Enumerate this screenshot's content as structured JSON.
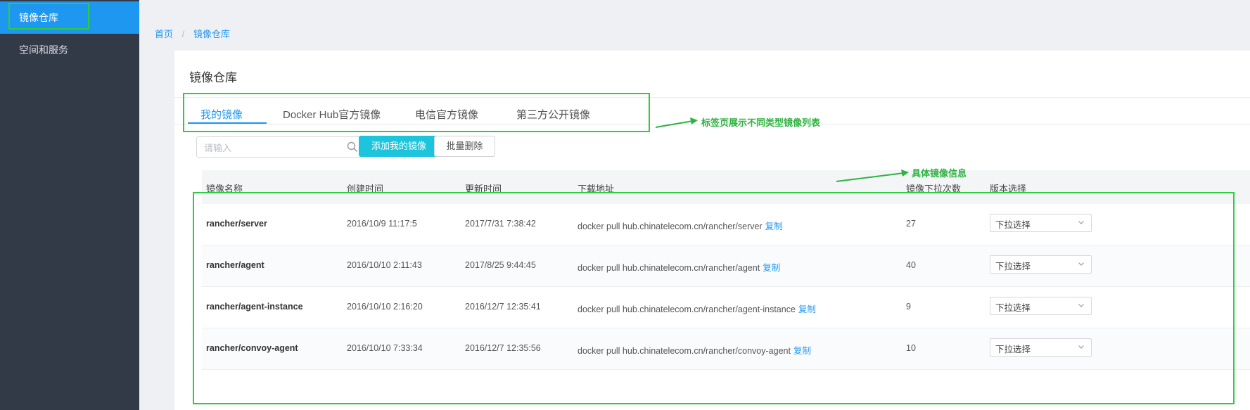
{
  "sidebar": {
    "items": [
      {
        "label": "镜像仓库"
      },
      {
        "label": "空间和服务"
      }
    ]
  },
  "breadcrumb": {
    "home": "首页",
    "current": "镜像仓库"
  },
  "page": {
    "title": "镜像仓库"
  },
  "tabs": [
    {
      "label": "我的镜像"
    },
    {
      "label": "Docker Hub官方镜像"
    },
    {
      "label": "电信官方镜像"
    },
    {
      "label": "第三方公开镜像"
    }
  ],
  "search": {
    "placeholder": "请输入"
  },
  "buttons": {
    "add": "添加我的镜像",
    "batch_delete": "批量删除"
  },
  "annotations": {
    "tabs_note": "标签页展示不同类型镜像列表",
    "table_note": "具体镜像信息"
  },
  "table": {
    "headers": [
      "镜像名称",
      "创建时间",
      "更新时间",
      "下载地址",
      "镜像下拉次数",
      "版本选择"
    ],
    "copy_label": "复制",
    "select_placeholder": "下拉选择",
    "rows": [
      {
        "name": "rancher/server",
        "created": "2016/10/9 11:17:5",
        "updated": "2017/7/31 7:38:42",
        "pull": "docker pull hub.chinatelecom.cn/rancher/server",
        "count": "27"
      },
      {
        "name": "rancher/agent",
        "created": "2016/10/10 2:11:43",
        "updated": "2017/8/25 9:44:45",
        "pull": "docker pull hub.chinatelecom.cn/rancher/agent",
        "count": "40"
      },
      {
        "name": "rancher/agent-instance",
        "created": "2016/10/10 2:16:20",
        "updated": "2016/12/7 12:35:41",
        "pull": "docker pull hub.chinatelecom.cn/rancher/agent-instance",
        "count": "9"
      },
      {
        "name": "rancher/convoy-agent",
        "created": "2016/10/10 7:33:34",
        "updated": "2016/12/7 12:35:56",
        "pull": "docker pull hub.chinatelecom.cn/rancher/convoy-agent",
        "count": "10"
      }
    ]
  },
  "colors": {
    "accent": "#1e97f0",
    "primary_button": "#1cc5dc",
    "annotation": "#2ecc40",
    "sidebar": "#333a47"
  }
}
